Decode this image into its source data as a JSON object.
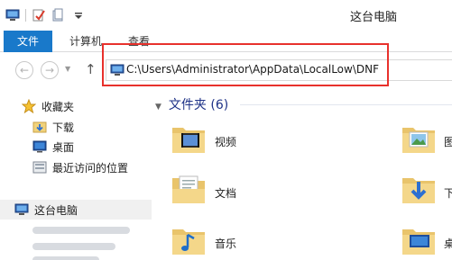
{
  "window": {
    "title": "这台电脑"
  },
  "ribbon": {
    "tabs": [
      "文件",
      "计算机",
      "查看"
    ]
  },
  "address": {
    "path": "C:\\Users\\Administrator\\AppData\\LocalLow\\DNF"
  },
  "nav_pane": {
    "favorites_label": "收藏夹",
    "items": [
      "下载",
      "桌面",
      "最近访问的位置"
    ],
    "this_pc_label": "这台电脑"
  },
  "content": {
    "section_title": "文件夹 (6)",
    "folders": [
      "视频",
      "图",
      "文档",
      "下",
      "音乐",
      "桌"
    ]
  },
  "colors": {
    "accent": "#1979ca",
    "highlight": "#e8312c",
    "section_text": "#1e3287"
  }
}
